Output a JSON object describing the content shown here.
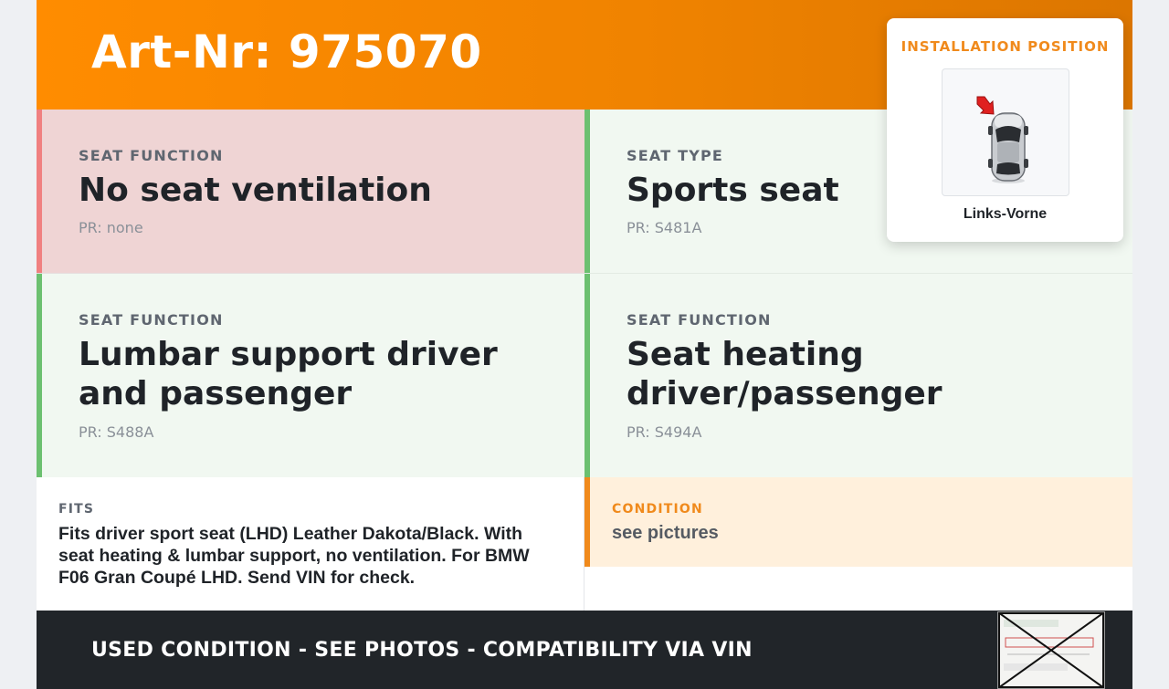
{
  "header": {
    "title": "Art-Nr: 975070"
  },
  "installation": {
    "title": "INSTALLATION POSITION",
    "position_label": "Links-Vorne",
    "image_icon": "car-top-view-icon",
    "arrow_color": "#e02020"
  },
  "features": [
    {
      "label": "SEAT FUNCTION",
      "value": "No seat ventilation",
      "pr": "PR: none",
      "status": "negative"
    },
    {
      "label": "SEAT TYPE",
      "value": "Sports seat",
      "pr": "PR: S481A",
      "status": "positive"
    },
    {
      "label": "SEAT FUNCTION",
      "value": "Lumbar support driver and passenger",
      "pr": "PR: S488A",
      "status": "positive"
    },
    {
      "label": "SEAT FUNCTION",
      "value": "Seat heating driver/passenger",
      "pr": "PR: S494A",
      "status": "positive"
    }
  ],
  "fits": {
    "label": "FITS",
    "text": "Fits driver sport seat (LHD) Leather Dakota/Black. With seat heating & lumbar support, no ventilation. For BMW F06 Gran Coupé LHD. Send VIN for check."
  },
  "condition": {
    "label": "CONDITION",
    "text": "see pictures"
  },
  "footer": {
    "text": "USED CONDITION - SEE PHOTOS - COMPATIBILITY VIA VIN",
    "thumbnail_icon": "label-sticker-photo-icon"
  },
  "colors": {
    "brand_orange": "#f08a1c",
    "negative_bg": "#efd4d4",
    "negative_accent": "#f08080",
    "positive_bg": "#f1f8f1",
    "positive_accent": "#6cc070",
    "condition_bg": "#fff0dc",
    "footer_bg": "#212529"
  }
}
